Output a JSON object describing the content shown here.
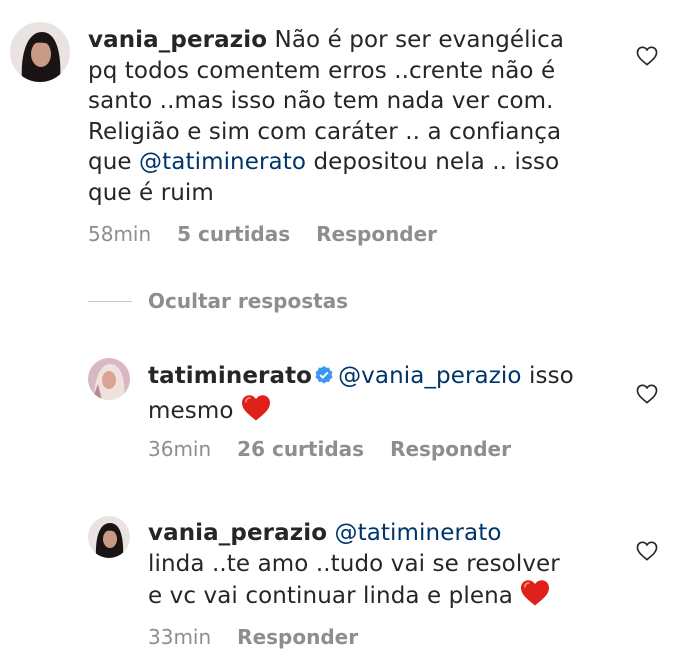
{
  "comments": [
    {
      "username": "vania_perazio",
      "text_line1": "Não é por ser evangélica",
      "text_line2": "pq todos comentem erros ..crente não é",
      "text_line3": "santo ..mas isso não tem nada ver com.",
      "text_line4": "Religião e sim com caráter .. a confiança",
      "text_line5_pre": "que ",
      "mention": "@tatiminerato",
      "text_line5_post": " depositou nela .. isso",
      "text_line6": "que é ruim",
      "time": "58min",
      "likes": "5 curtidas",
      "reply": "Responder"
    }
  ],
  "hide_replies": "Ocultar respostas",
  "replies": [
    {
      "username": "tatiminerato",
      "mention": "@vania_perazio",
      "text_after_mention": " isso",
      "text_line2": "mesmo",
      "time": "36min",
      "likes": "26 curtidas",
      "reply": "Responder"
    },
    {
      "username": "vania_perazio",
      "mention": "@tatiminerato",
      "text_line2": "linda ..te amo ..tudo vai se resolver",
      "text_line3": "e vc vai continuar linda e plena",
      "time": "33min",
      "reply": "Responder"
    }
  ],
  "colors": {
    "mention": "#003569",
    "meta": "#8e8e8e",
    "heart_red": "#e0201b",
    "verified_blue": "#3897f0"
  },
  "icons": [
    "heart-outline-icon",
    "verified-badge-icon",
    "red-heart-emoji-icon"
  ]
}
